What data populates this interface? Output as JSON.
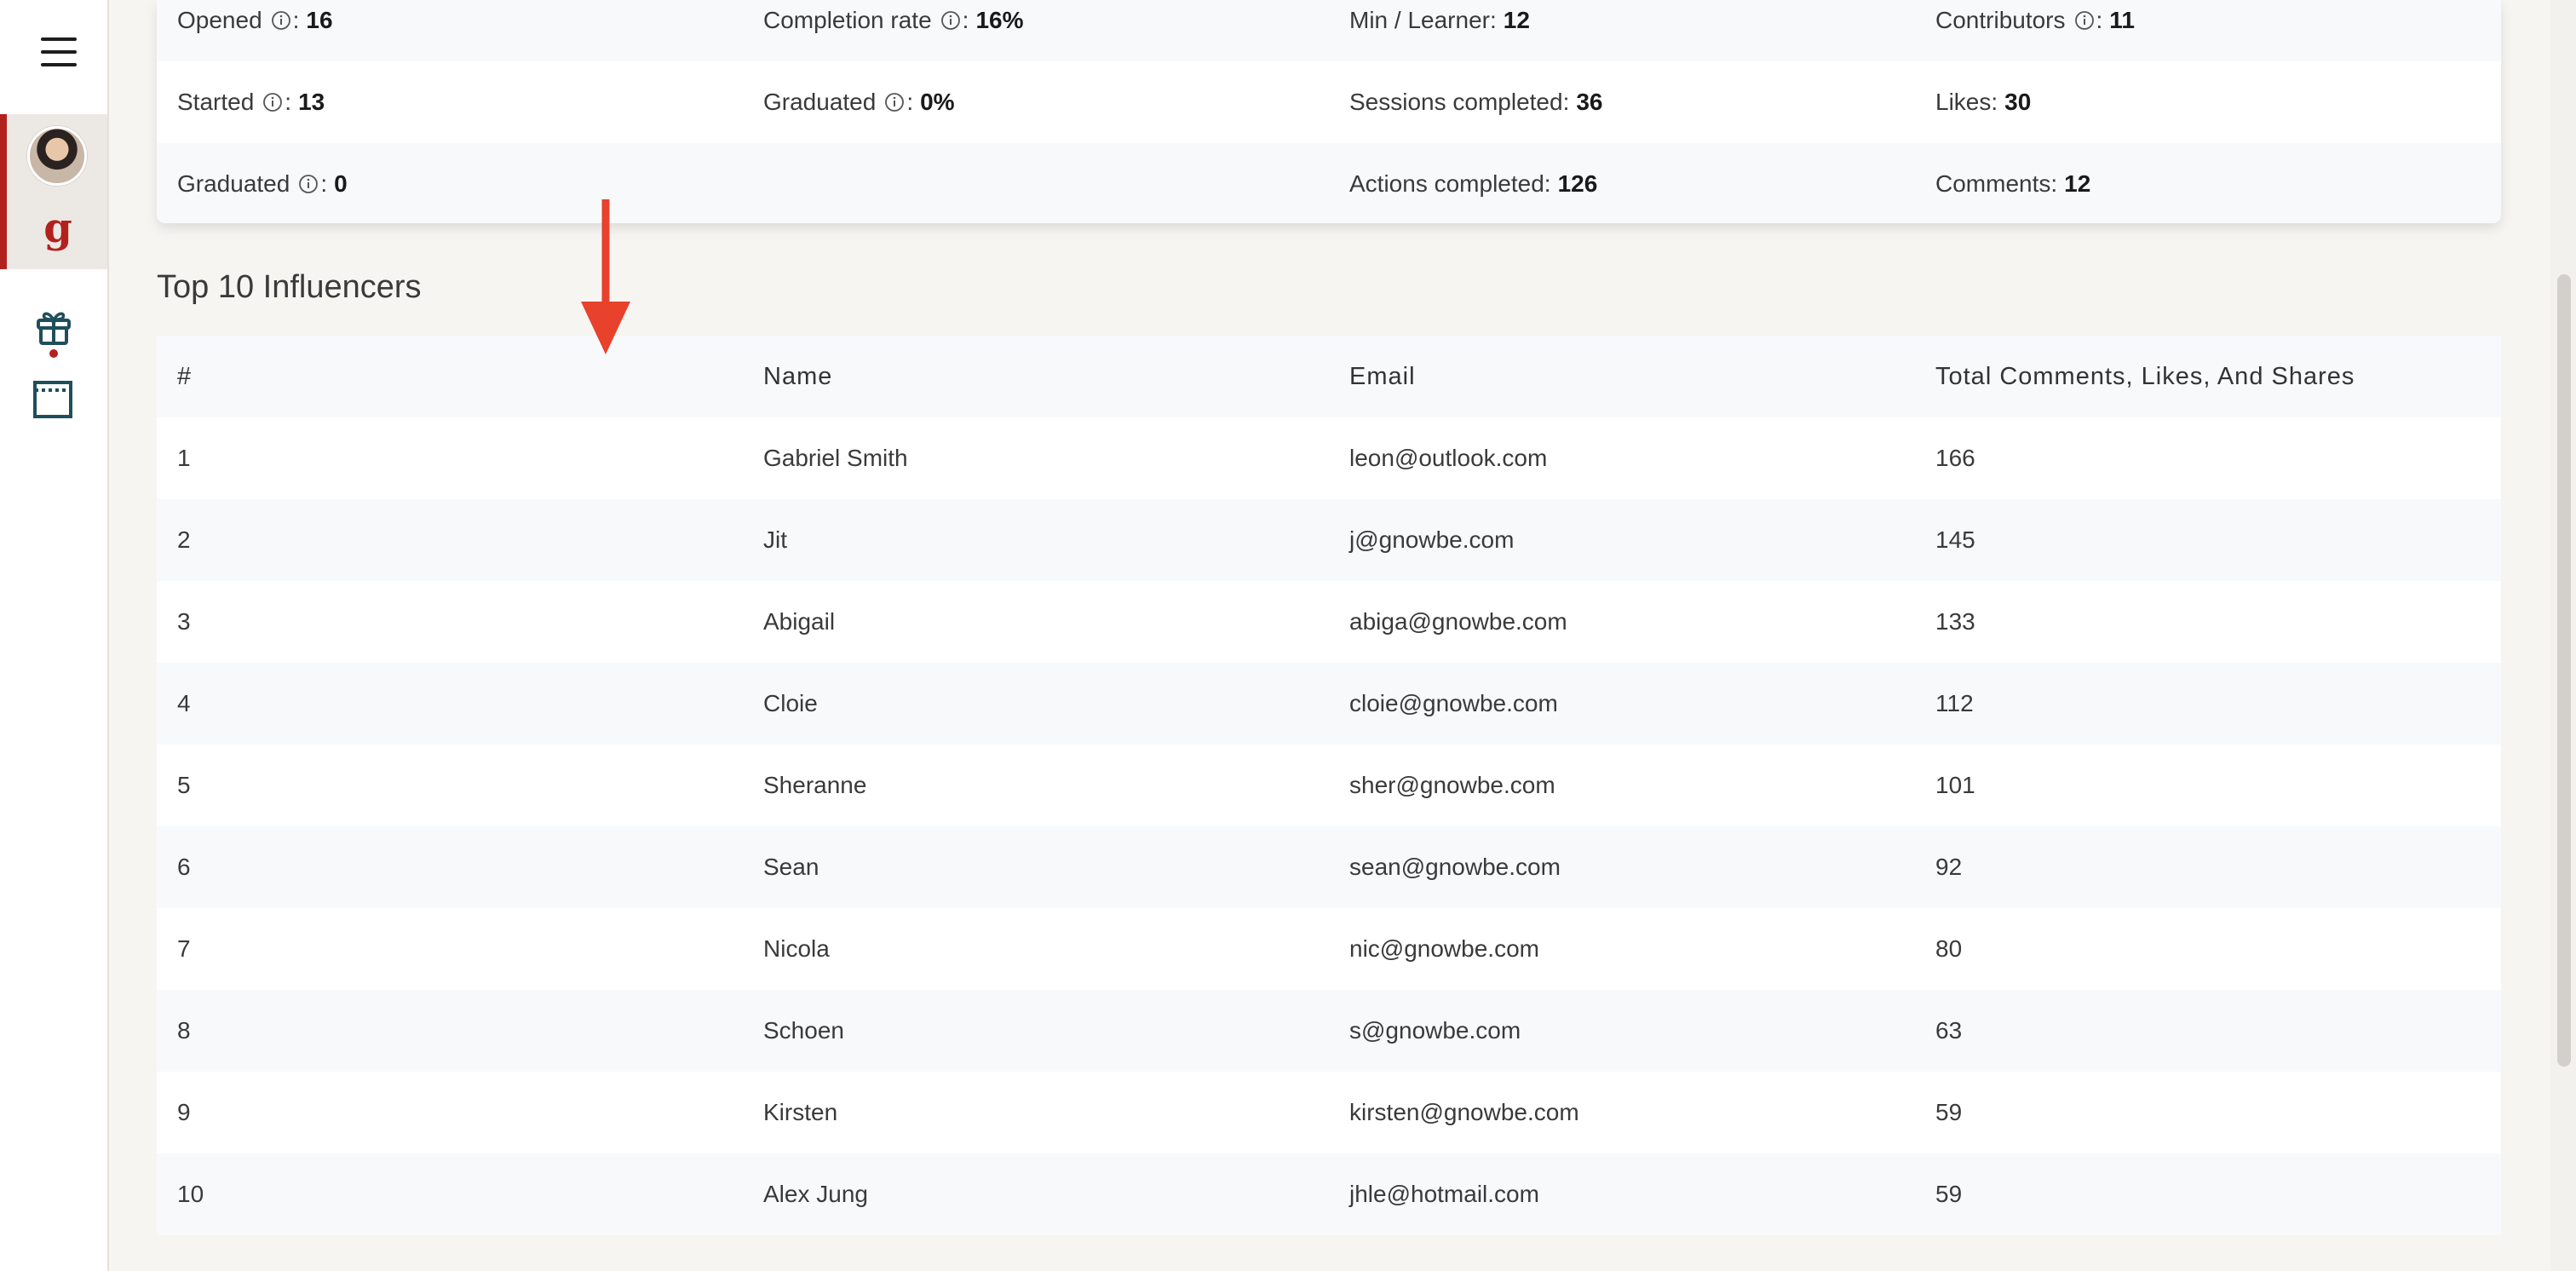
{
  "stats": {
    "rows": [
      [
        {
          "label": "Opened",
          "info": true,
          "value": "16"
        },
        {
          "label": "Completion rate",
          "info": true,
          "value": "16%"
        },
        {
          "label": "Min / Learner:",
          "info": false,
          "value": "12"
        },
        {
          "label": "Contributors",
          "info": true,
          "value": "11"
        }
      ],
      [
        {
          "label": "Started",
          "info": true,
          "value": "13"
        },
        {
          "label": "Graduated",
          "info": true,
          "value": "0%"
        },
        {
          "label": "Sessions completed:",
          "info": false,
          "value": "36"
        },
        {
          "label": "Likes:",
          "info": false,
          "value": "30"
        }
      ],
      [
        {
          "label": "Graduated",
          "info": true,
          "value": "0"
        },
        null,
        {
          "label": "Actions completed:",
          "info": false,
          "value": "126"
        },
        {
          "label": "Comments:",
          "info": false,
          "value": "12"
        }
      ]
    ]
  },
  "influencers": {
    "title": "Top 10 Influencers",
    "columns": [
      "#",
      "Name",
      "Email",
      "Total Comments, Likes, And Shares"
    ],
    "rows": [
      [
        "1",
        "Gabriel Smith",
        "leon@outlook.com",
        "166"
      ],
      [
        "2",
        "Jit",
        "j@gnowbe.com",
        "145"
      ],
      [
        "3",
        "Abigail",
        "abiga@gnowbe.com",
        "133"
      ],
      [
        "4",
        "Cloie",
        "cloie@gnowbe.com",
        "112"
      ],
      [
        "5",
        "Sheranne",
        "sher@gnowbe.com",
        "101"
      ],
      [
        "6",
        "Sean",
        "sean@gnowbe.com",
        "92"
      ],
      [
        "7",
        "Nicola",
        "nic@gnowbe.com",
        "80"
      ],
      [
        "8",
        "Schoen",
        "s@gnowbe.com",
        "63"
      ],
      [
        "9",
        "Kirsten",
        "kirsten@gnowbe.com",
        "59"
      ],
      [
        "10",
        "Alex Jung",
        "jhle@hotmail.com",
        "59"
      ]
    ]
  },
  "sidebar": {
    "brand_letter": "g",
    "icons": [
      "menu-icon",
      "avatar",
      "brand-icon",
      "gift-icon",
      "window-icon"
    ]
  },
  "colors": {
    "accent": "#b3211f",
    "annotation_arrow": "#e8412c",
    "row_alt": "#f8f9fb",
    "page_bg": "#f7f5f2"
  }
}
